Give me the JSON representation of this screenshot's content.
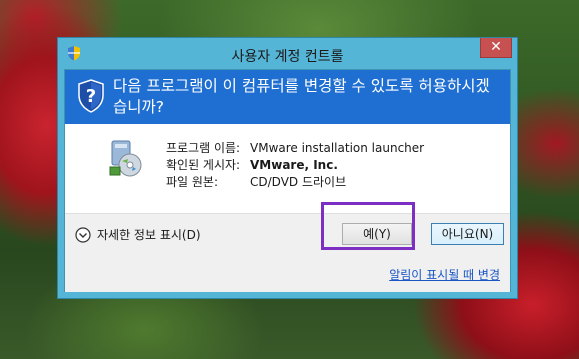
{
  "dialog": {
    "title": "사용자 계정 컨트롤",
    "close_label": "✕",
    "question": "다음 프로그램이 이 컴퓨터를 변경할 수 있도록 허용하시겠습니까?",
    "info": [
      {
        "label": "프로그램 이름:",
        "value": "VMware installation launcher"
      },
      {
        "label": "확인된 게시자:",
        "value": "VMware, Inc."
      },
      {
        "label": "파일 원본:",
        "value": "CD/DVD 드라이브"
      }
    ],
    "details_label": "자세한 정보 표시(D)",
    "yes_label": "예(Y)",
    "no_label": "아니요(N)",
    "notify_link": "알림이 표시될 때 변경",
    "colors": {
      "header_bg": "#1f6fd3",
      "frame": "#55b5d6",
      "highlight": "#7d2fc4",
      "close": "#c75050"
    },
    "icons": [
      "uac-shield-icon",
      "question-shield-icon",
      "program-icon",
      "chevron-down-icon",
      "close-icon"
    ]
  }
}
